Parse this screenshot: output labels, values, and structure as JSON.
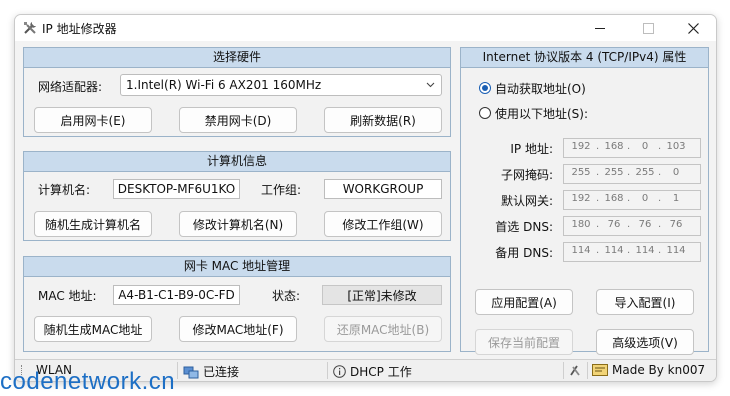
{
  "window": {
    "title": "IP 地址修改器",
    "icon": "tools-icon"
  },
  "hardware": {
    "header": "选择硬件",
    "adapter_label": "网络适配器:",
    "adapter_value": "1.Intel(R) Wi-Fi 6 AX201 160MHz",
    "enable_button": "启用网卡(E)",
    "disable_button": "禁用网卡(D)",
    "refresh_button": "刷新数据(R)"
  },
  "computer": {
    "header": "计算机信息",
    "name_label": "计算机名:",
    "name_value": "DESKTOP-MF6U1KO",
    "group_label": "工作组:",
    "group_value": "WORKGROUP",
    "random_name_button": "随机生成计算机名",
    "modify_name_button": "修改计算机名(N)",
    "modify_group_button": "修改工作组(W)"
  },
  "mac": {
    "header": "网卡 MAC 地址管理",
    "mac_label": "MAC 地址:",
    "mac_value": "A4-B1-C1-B9-0C-FD",
    "state_label": "状态:",
    "state_value": "[正常]未修改",
    "random_mac_button": "随机生成MAC地址",
    "modify_mac_button": "修改MAC地址(F)",
    "restore_mac_button": "还原MAC地址(B)"
  },
  "ipv4": {
    "header": "Internet 协议版本 4 (TCP/IPv4) 属性",
    "auto_radio": "自动获取地址(O)",
    "manual_radio": "使用以下地址(S):",
    "selected": "auto",
    "fields": [
      {
        "label": "IP 地址:",
        "octets": [
          "192",
          "168",
          "0",
          "103"
        ]
      },
      {
        "label": "子网掩码:",
        "octets": [
          "255",
          "255",
          "255",
          "0"
        ]
      },
      {
        "label": "默认网关:",
        "octets": [
          "192",
          "168",
          "0",
          "1"
        ]
      },
      {
        "label": "首选 DNS:",
        "octets": [
          "180",
          "76",
          "76",
          "76"
        ]
      },
      {
        "label": "备用 DNS:",
        "octets": [
          "114",
          "114",
          "114",
          "114"
        ]
      }
    ],
    "apply_button": "应用配置(A)",
    "import_button": "导入配置(I)",
    "save_button": "保存当前配置",
    "advanced_button": "高级选项(V)"
  },
  "statusbar": {
    "interface": "WLAN",
    "connection": "已连接",
    "mode": "DHCP 工作",
    "author": "Made By kn007"
  },
  "watermark": "codenetwork.cn",
  "colors": {
    "panel_header": "#c9dbed",
    "panel_border": "#9bb3c9",
    "watermark": "#1d6fc5",
    "radio_selected": "#1a5fb4"
  }
}
